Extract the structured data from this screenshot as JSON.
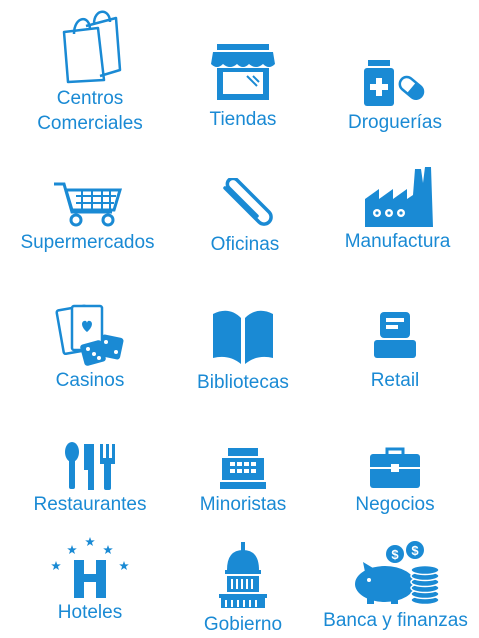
{
  "accent_color": "#1a8ad4",
  "items": [
    {
      "label": "Centros",
      "label2": "Comerciales",
      "icon": "shopping-bags-icon"
    },
    {
      "label": "Tiendas",
      "icon": "storefront-icon"
    },
    {
      "label": "Droguerías",
      "icon": "pill-bottle-icon"
    },
    {
      "label": "Supermercados",
      "icon": "shopping-cart-icon"
    },
    {
      "label": "Oficinas",
      "icon": "paperclip-icon"
    },
    {
      "label": "Manufactura",
      "icon": "factory-icon"
    },
    {
      "label": "Casinos",
      "icon": "cards-dice-icon"
    },
    {
      "label": "Bibliotecas",
      "icon": "open-book-icon"
    },
    {
      "label": "Retail",
      "icon": "pos-terminal-icon"
    },
    {
      "label": "Restaurantes",
      "icon": "cutlery-icon"
    },
    {
      "label": "Minoristas",
      "icon": "cash-register-icon"
    },
    {
      "label": "Negocios",
      "icon": "briefcase-icon"
    },
    {
      "label": "Hoteles",
      "icon": "hotel-stars-icon"
    },
    {
      "label": "Gobierno",
      "icon": "capitol-dome-icon"
    },
    {
      "label": "Banca y finanzas",
      "icon": "piggy-bank-coins-icon"
    }
  ]
}
